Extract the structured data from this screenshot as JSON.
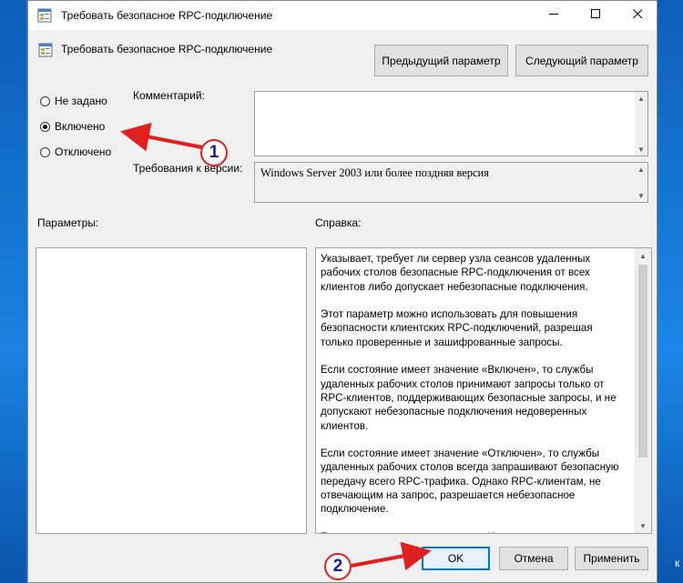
{
  "window": {
    "title": "Требовать безопасное RPC-подключение",
    "policy_name": "Требовать безопасное RPC-подключение"
  },
  "nav": {
    "prev_label": "Предыдущий параметр",
    "next_label": "Следующий параметр"
  },
  "state": {
    "options": [
      {
        "label": "Не задано",
        "checked": false
      },
      {
        "label": "Включено",
        "checked": true
      },
      {
        "label": "Отключено",
        "checked": false
      }
    ]
  },
  "comment": {
    "label": "Комментарий:",
    "value": ""
  },
  "supported": {
    "label": "Требования к версии:",
    "value": "Windows Server 2003 или более поздняя версия"
  },
  "options_section": {
    "label": "Параметры:"
  },
  "help_section": {
    "label": "Справка:",
    "text": "Указывает, требует ли сервер узла сеансов удаленных\nрабочих столов безопасные RPC-подключения от всех\nклиентов либо допускает небезопасные подключения.\n\nЭтот параметр можно использовать для повышения\nбезопасности клиентских RPC-подключений, разрешая\nтолько проверенные и зашифрованные запросы.\n\nЕсли состояние имеет значение «Включен», то службы\nудаленных рабочих столов принимают запросы только от\nRPC-клиентов, поддерживающих безопасные запросы, и не\nдопускают небезопасные подключения недоверенных\nклиентов.\n\nЕсли состояние имеет значение «Отключен», то службы\nудаленных рабочих столов всегда запрашивают безопасную\nпередачу всего RPC-трафика. Однако RPC-клиентам, не\nотвечающим на запрос, разрешается небезопасное\nподключение.\n\nЕсли состояние имеет значение «Не задан», допускаются"
  },
  "footer": {
    "ok_label": "OK",
    "cancel_label": "Отмена",
    "apply_label": "Применить"
  },
  "annotations": {
    "step1": "1",
    "step2": "2",
    "arrow_color": "#e02020"
  },
  "desktop": {
    "edge_text": "к"
  }
}
